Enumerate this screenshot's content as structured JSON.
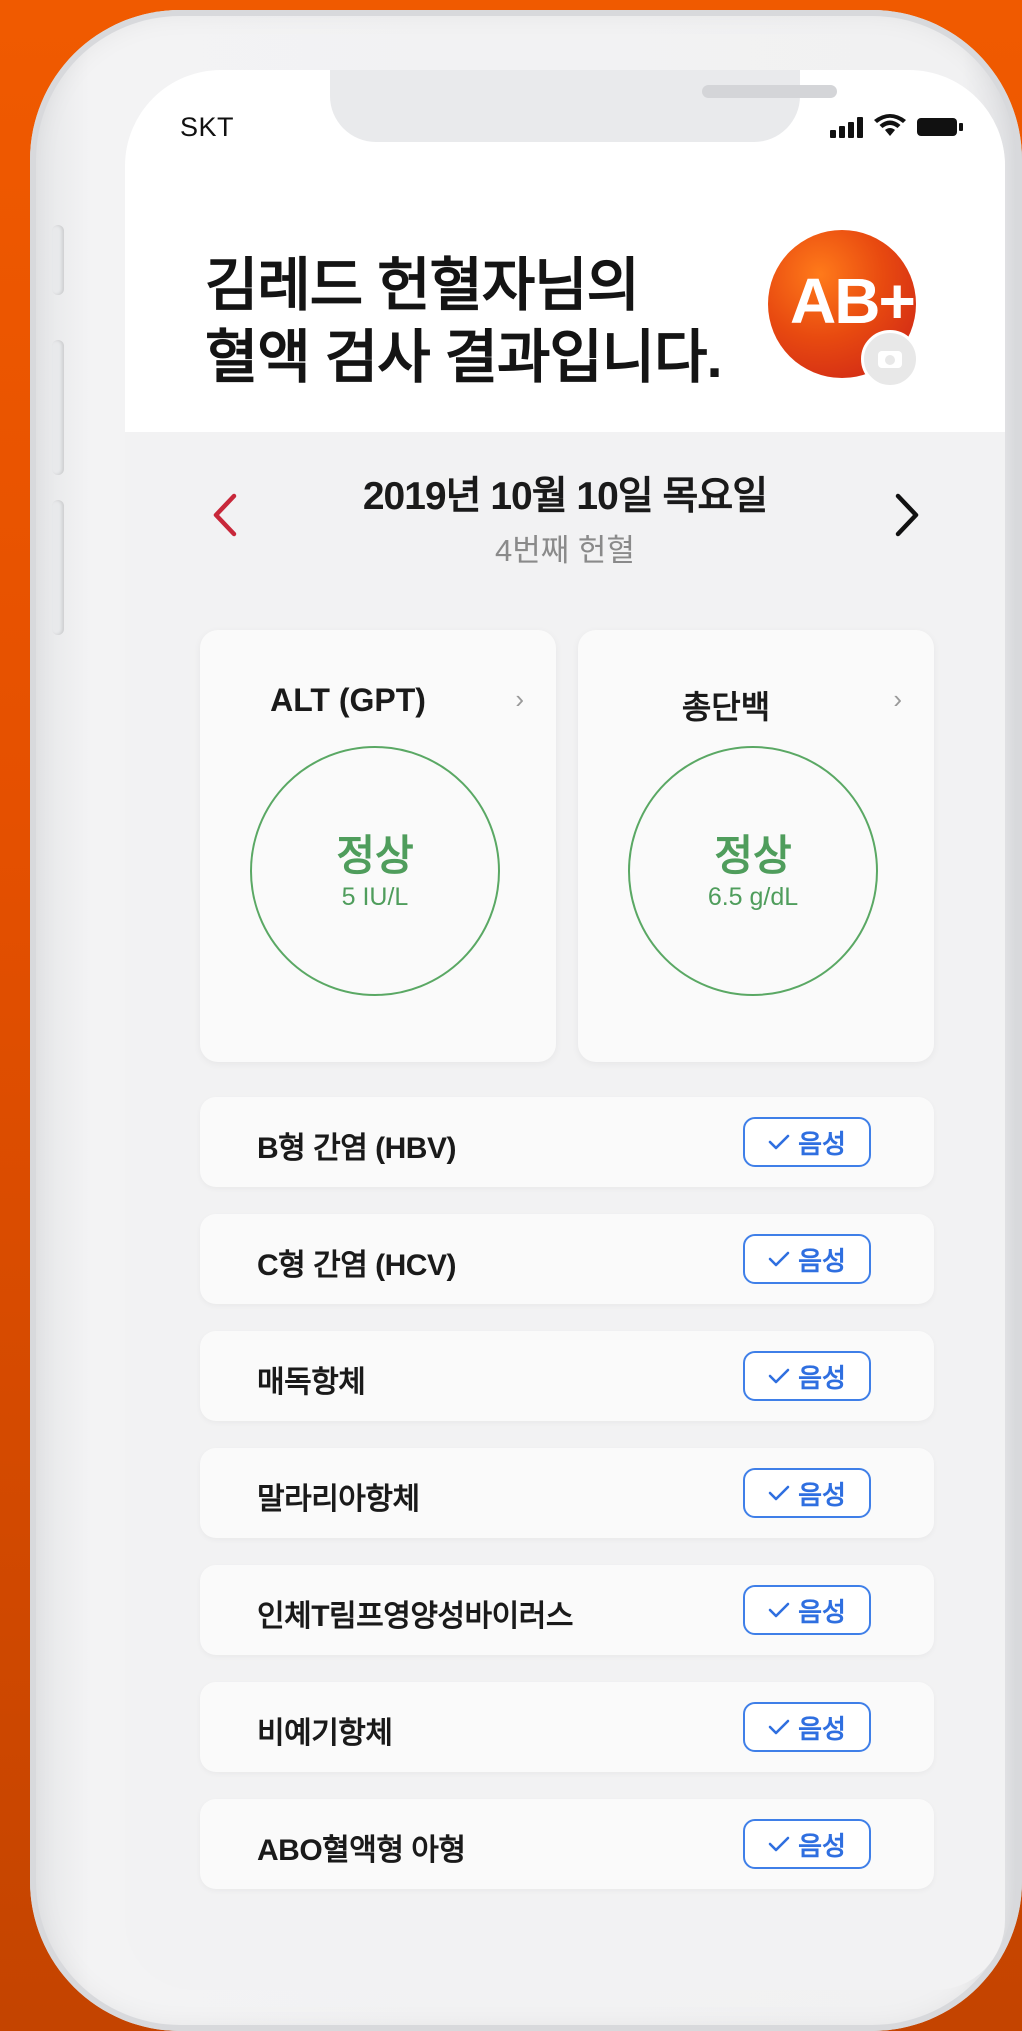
{
  "status_bar": {
    "carrier": "SKT"
  },
  "header": {
    "title_line1": "김레드 헌혈자님의",
    "title_line2": "혈액 검사 결과입니다.",
    "blood_type": "AB+"
  },
  "date_nav": {
    "date": "2019년 10월 10일 목요일",
    "donation_count": "4번째 헌혈"
  },
  "cards": [
    {
      "title": "ALT (GPT)",
      "status": "정상",
      "value": "5 IU/L"
    },
    {
      "title": "총단백",
      "status": "정상",
      "value": "6.5 g/dL"
    }
  ],
  "results": [
    {
      "label": "B형 간염 (HBV)",
      "result": "음성"
    },
    {
      "label": "C형 간염 (HCV)",
      "result": "음성"
    },
    {
      "label": "매독항체",
      "result": "음성"
    },
    {
      "label": "말라리아항체",
      "result": "음성"
    },
    {
      "label": "인체T림프영양성바이러스",
      "result": "음성"
    },
    {
      "label": "비예기항체",
      "result": "음성"
    },
    {
      "label": "ABO혈액형 아형",
      "result": "음성"
    }
  ],
  "colors": {
    "background_orange": "#f05a00",
    "normal_green": "#4f9d5c",
    "negative_blue": "#2f6fe0",
    "prev_arrow_red": "#c8283a",
    "badge_gradient_start": "#ff7a1a",
    "badge_gradient_end": "#c91e18"
  },
  "icons": {
    "prev": "chevron-left-icon",
    "next": "chevron-right-icon",
    "card_link": "chevron-right-icon",
    "result": "check-icon",
    "camera": "camera-icon"
  }
}
